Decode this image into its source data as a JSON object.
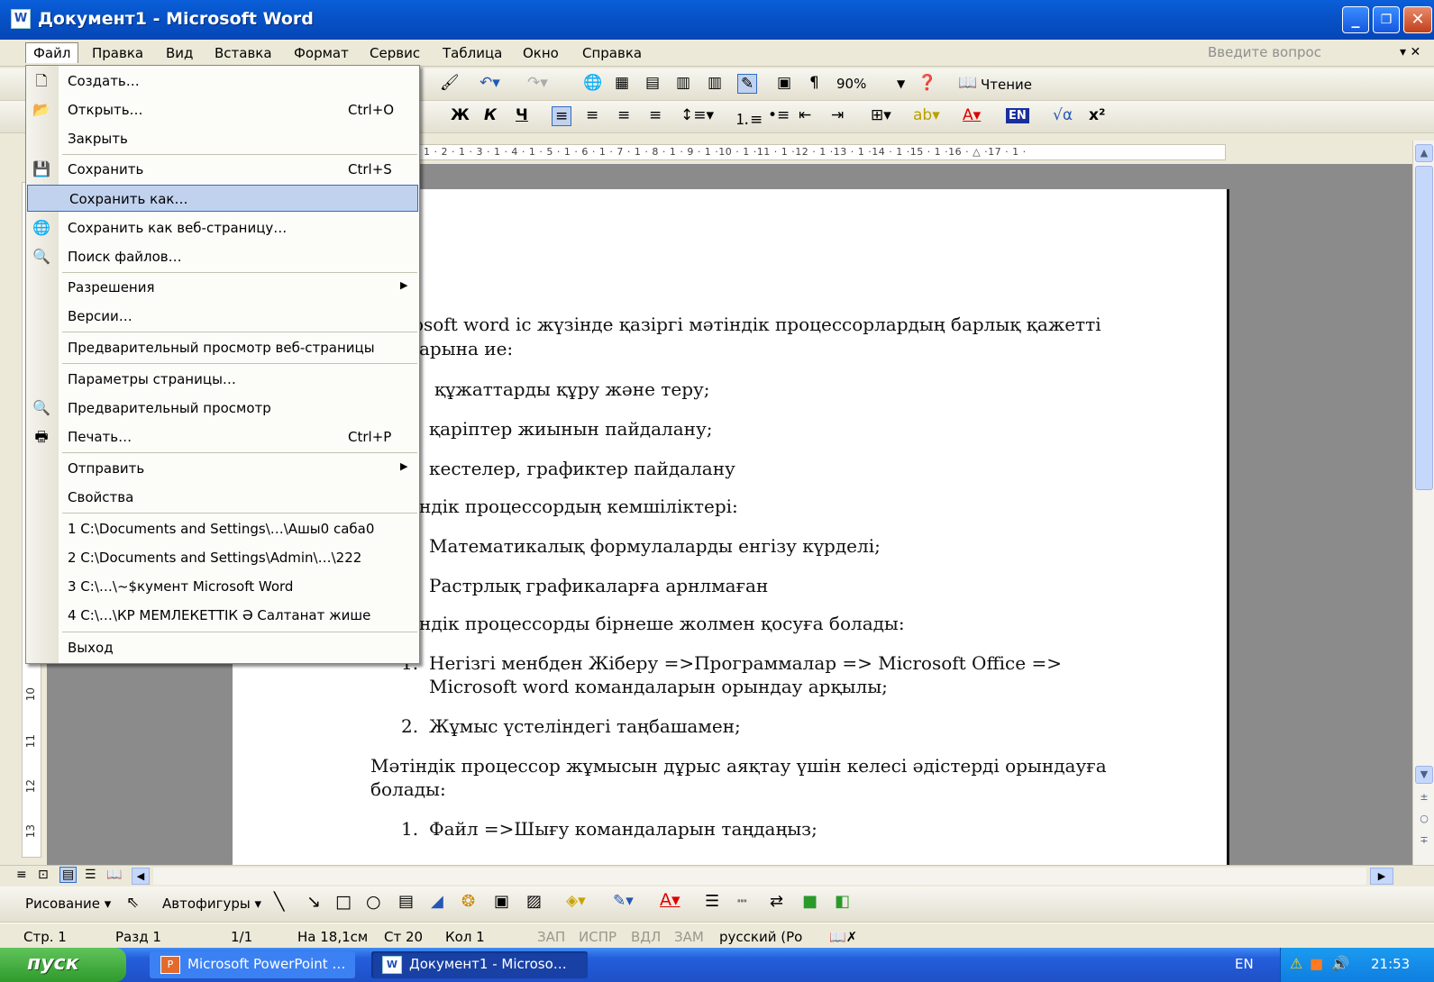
{
  "window": {
    "title": "Документ1 - Microsoft Word",
    "min": "_",
    "max": "❐",
    "close": "✕"
  },
  "menubar": {
    "items": [
      "Файл",
      "Правка",
      "Вид",
      "Вставка",
      "Формат",
      "Сервис",
      "Таблица",
      "Окно",
      "Справка"
    ],
    "ask_placeholder": "Введите вопрос",
    "ask_arrow": "▾ ✕"
  },
  "toolbar": {
    "zoom": "90%",
    "reading": "Чтение"
  },
  "format_toolbar": {
    "bold": "Ж",
    "italic": "К",
    "underline": "Ч",
    "lang": "EN"
  },
  "ruler_text": "· 1 · 2 · 1 · 3 · 1 · 4 · 1 · 5 · 1 · 6 · 1 · 7 · 1 · 8 · 1 · 9 · 1 ·10 · 1 ·11 · 1 ·12 · 1 ·13 · 1 ·14 · 1 ·15 · 1 ·16 · △ ·17 · 1 ·",
  "vruler": [
    "10",
    "11",
    "12",
    "13"
  ],
  "file_menu": {
    "items": [
      {
        "label": "Создать…",
        "shortcut": ""
      },
      {
        "label": "Открыть…",
        "shortcut": "Ctrl+O"
      },
      {
        "label": "Закрыть",
        "shortcut": ""
      },
      {
        "label": "Сохранить",
        "shortcut": "Ctrl+S"
      },
      {
        "label": "Сохранить как…",
        "shortcut": ""
      },
      {
        "label": "Сохранить как веб-страницу…",
        "shortcut": ""
      },
      {
        "label": "Поиск файлов…",
        "shortcut": ""
      },
      {
        "label": "Разрешения",
        "shortcut": ""
      },
      {
        "label": "Версии…",
        "shortcut": ""
      },
      {
        "label": "Предварительный просмотр веб-страницы",
        "shortcut": ""
      },
      {
        "label": "Параметры страницы…",
        "shortcut": ""
      },
      {
        "label": "Предварительный просмотр",
        "shortcut": ""
      },
      {
        "label": "Печать…",
        "shortcut": "Ctrl+P"
      },
      {
        "label": "Отправить",
        "shortcut": ""
      },
      {
        "label": "Свойства",
        "shortcut": ""
      },
      {
        "label": "1 C:\\Documents and Settings\\…\\Ашы0 саба0",
        "shortcut": ""
      },
      {
        "label": "2 C:\\Documents and Settings\\Admin\\…\\222",
        "shortcut": ""
      },
      {
        "label": "3 C:\\…\\~$кумент Microsoft Word",
        "shortcut": ""
      },
      {
        "label": "4 C:\\…\\КР МЕМЛЕКЕТТІК Ә Салтанат жише",
        "shortcut": ""
      },
      {
        "label": "Выход",
        "shortcut": ""
      }
    ]
  },
  "document": {
    "lines": [
      "osoft  word  іс жүзінде қазіргі мәтіндік процессорлардың  барлық қажетті",
      "арына ие:",
      "құжаттарды құру және теру;",
      "қаріптер жиынын пайдалану;",
      "кестелер, графиктер пайдалану",
      "ндік процессордың кемшіліктері:",
      "Математикалық формулаларды енгізу күрделі;",
      "Растрлық графикаларға арнлмаған",
      "ндік процессорды бірнеше жолмен қосуға болады:",
      "1.",
      "Негізгі менбден Жіберу =>Программалар => Microsoft  Office =>",
      "Microsoft  word  командаларын орындау арқылы;",
      "2.",
      "Жұмыс үстеліндегі таңбашамен;",
      "Мәтіндік процессор жұмысын дұрыс аяқтау үшін келесі әдістерді орындауға",
      "болады:",
      "1.",
      "Файл =>Шығу командаларын таңдаңыз;"
    ]
  },
  "drawing_toolbar": {
    "draw": "Рисование ▾",
    "autoshapes": "Автофигуры ▾"
  },
  "statusbar": {
    "page": "Стр. 1",
    "section": "Разд 1",
    "pages": "1/1",
    "at": "На 18,1см",
    "line": "Ст 20",
    "col": "Кол 1",
    "rec": "ЗАП",
    "trk": "ИСПР",
    "ext": "ВДЛ",
    "ovr": "ЗАМ",
    "language": "русский (Ро"
  },
  "taskbar": {
    "start": "пуск",
    "tasks": [
      "Microsoft PowerPoint …",
      "Документ1 - Microso…"
    ],
    "lang": "EN",
    "clock": "21:53"
  }
}
